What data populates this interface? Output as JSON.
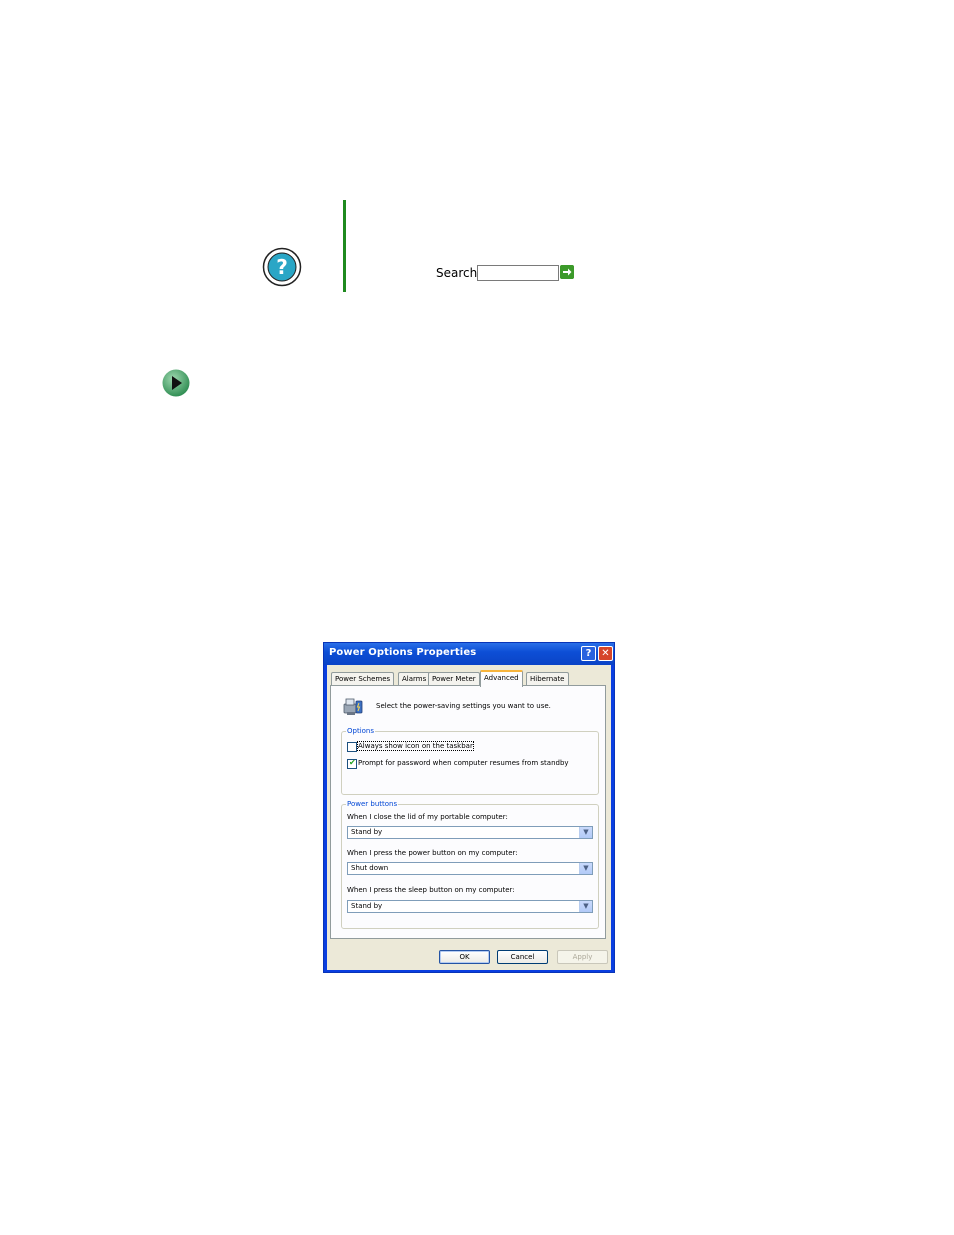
{
  "help": {
    "search_label": "Search",
    "search_value": "",
    "icons": {
      "help": "question-mark-circle-icon",
      "go": "green-arrow-icon",
      "bullet": "play-arrow-icon"
    },
    "accent_color": "#1f8a1f"
  },
  "dialog": {
    "title": "Power Options Properties",
    "titlebar_buttons": {
      "help": "?",
      "close": "✕"
    },
    "tabs": [
      {
        "label": "Power Schemes",
        "active": false
      },
      {
        "label": "Alarms",
        "active": false
      },
      {
        "label": "Power Meter",
        "active": false
      },
      {
        "label": "Advanced",
        "active": true
      },
      {
        "label": "Hibernate",
        "active": false
      }
    ],
    "intro": "Select the power-saving settings you want to use.",
    "options": {
      "legend": "Options",
      "items": [
        {
          "label": "Always show icon on the taskbar",
          "checked": false
        },
        {
          "label": "Prompt for password when computer resumes from standby",
          "checked": true
        }
      ]
    },
    "power_buttons": {
      "legend": "Power buttons",
      "fields": [
        {
          "label": "When I close the lid of my portable computer:",
          "value": "Stand by"
        },
        {
          "label": "When I press the power button on my computer:",
          "value": "Shut down"
        },
        {
          "label": "When I press the sleep button on my computer:",
          "value": "Stand by"
        }
      ]
    },
    "buttons": {
      "ok": "OK",
      "cancel": "Cancel",
      "apply": "Apply"
    }
  }
}
